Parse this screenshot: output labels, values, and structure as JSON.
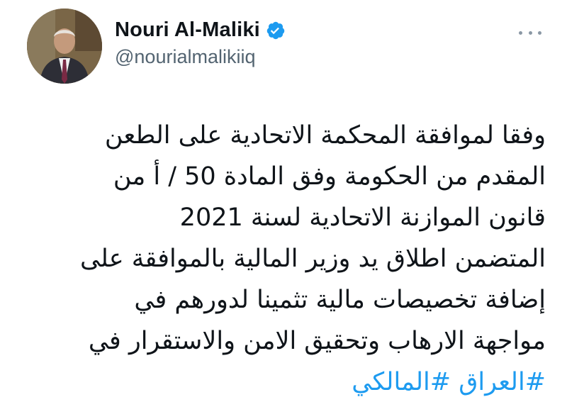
{
  "user": {
    "display_name": "Nouri Al-Maliki",
    "handle": "@nourialmalikiiq",
    "verified": true,
    "avatar_icon": "profile-photo",
    "verified_icon": "verified-badge-icon"
  },
  "menu": {
    "icon": "more-options-icon"
  },
  "tweet": {
    "lines": [
      "وفقا لموافقة المحكمة الاتحادية على الطعن",
      "المقدم من الحكومة وفق المادة 50 / أ من",
      "قانون الموازنة الاتحادية لسنة 2021",
      "المتضمن اطلاق يد وزير المالية بالموافقة على",
      "إضافة تخصيصات مالية تثمينا لدورهم في",
      "مواجهة الارهاب وتحقيق الامن والاستقرار في"
    ],
    "hashtags": "#العراق #المالكي"
  },
  "colors": {
    "text": "#0f1419",
    "secondary_text": "#536471",
    "link": "#1d9bf0",
    "verified": "#1d9bf0"
  }
}
